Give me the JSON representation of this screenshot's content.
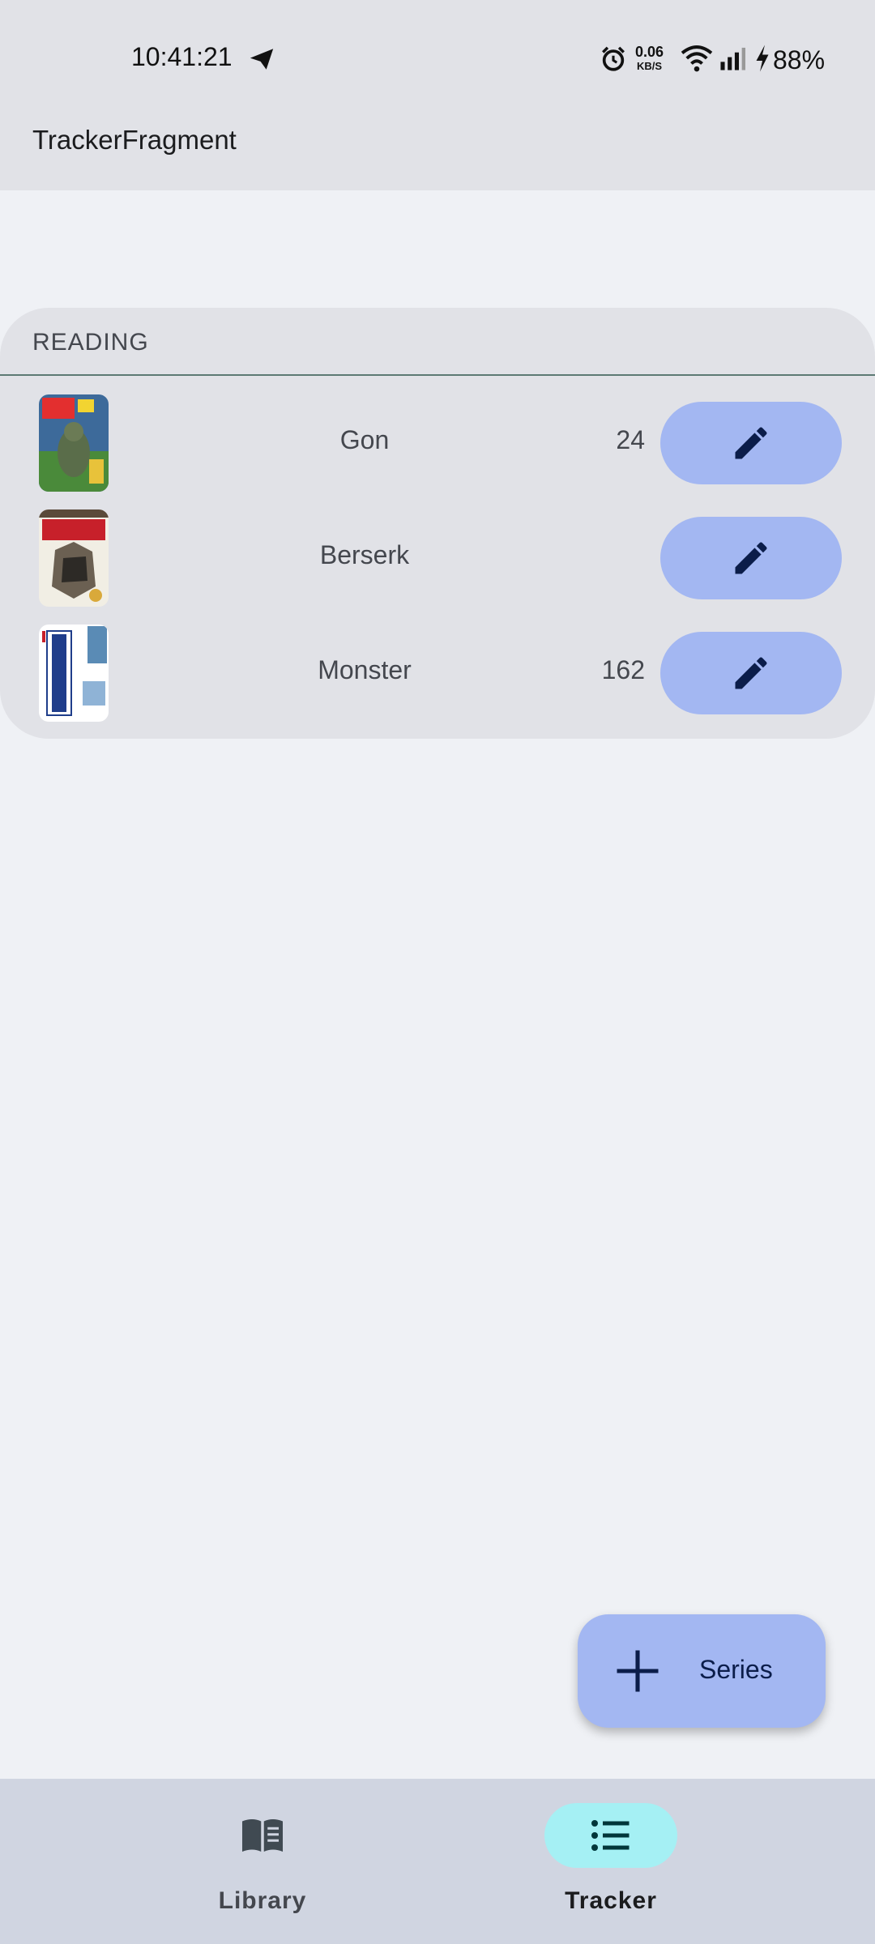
{
  "status_bar": {
    "time": "10:41:21",
    "net_speed_value": "0.06",
    "net_speed_unit": "KB/S",
    "battery": "88%",
    "icons": [
      "send-icon",
      "alarm-icon",
      "wifi-icon",
      "signal-icon",
      "charging-icon"
    ]
  },
  "app_bar": {
    "title": "TrackerFragment"
  },
  "section": {
    "header": "READING",
    "items": [
      {
        "title": "Gon",
        "count": "24",
        "cover": "gon-cover"
      },
      {
        "title": "Berserk",
        "count": "",
        "cover": "berserk-cover"
      },
      {
        "title": "Monster",
        "count": "162",
        "cover": "monster-cover"
      }
    ]
  },
  "fab": {
    "label": "Series",
    "icon": "plus-icon"
  },
  "bottom_nav": {
    "items": [
      {
        "label": "Library",
        "icon": "book-icon",
        "selected": false
      },
      {
        "label": "Tracker",
        "icon": "list-icon",
        "selected": true
      }
    ]
  },
  "colors": {
    "background": "#eff1f5",
    "surface": "#e1e2e7",
    "accent_button": "#a3b7f2",
    "nav_selected": "#a5f0f4",
    "divider": "#5d7a74"
  }
}
